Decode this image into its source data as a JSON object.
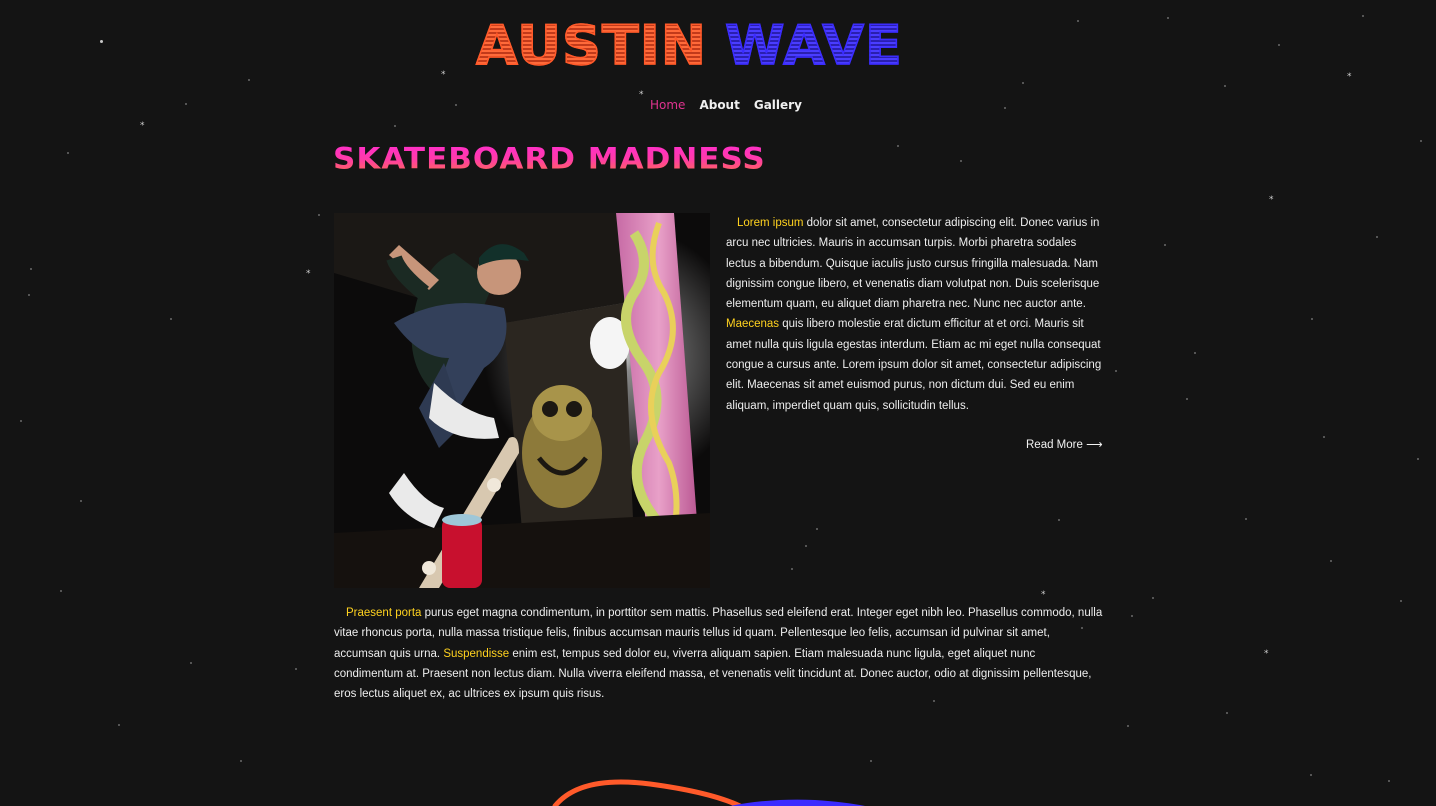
{
  "header": {
    "logo_word1": "AUSTIN",
    "logo_word2": "WAVE",
    "logo_colors": {
      "orange": "#ff5a2a",
      "blue": "#3b2cff"
    }
  },
  "nav": {
    "items": [
      {
        "label": "Home",
        "active": true
      },
      {
        "label": "About",
        "active": false
      },
      {
        "label": "Gallery",
        "active": false
      }
    ],
    "active_color": "#e0338f"
  },
  "post": {
    "title": "SKATEBOARD MADNESS",
    "title_gradient": [
      "#ff2bd6",
      "#ff7a3a"
    ],
    "image_icon": "skateboarder-photo",
    "para1": {
      "lead": "Lorem ipsum",
      "text1": " dolor sit amet, consectetur adipiscing elit. Donec varius in arcu nec ultricies. Mauris in accumsan turpis. Morbi pharetra sodales lectus a bibendum. Quisque iaculis justo cursus fringilla malesuada. Nam dignissim congue libero, et venenatis diam volutpat non. Duis scelerisque elementum quam, eu aliquet diam pharetra nec. Nunc nec auctor ante. ",
      "highlight2": "Maecenas",
      "text2": " quis libero molestie erat dictum efficitur at et orci. Mauris sit amet nulla quis ligula egestas interdum. Etiam ac mi eget nulla consequat congue a cursus ante. Lorem ipsum dolor sit amet, consectetur adipiscing elit. Maecenas sit amet euismod purus, non dictum dui. Sed eu enim aliquam, imperdiet quam quis, sollicitudin tellus."
    },
    "read_more": "Read More ⟶",
    "para2": {
      "lead": "Praesent porta",
      "text1": " purus eget magna condimentum, in porttitor sem mattis. Phasellus sed eleifend erat. Integer eget nibh leo. Phasellus commodo, nulla vitae rhoncus porta, nulla massa tristique felis, finibus accumsan mauris tellus id quam. Pellentesque leo felis, accumsan id pulvinar sit amet, accumsan quis urna. ",
      "highlight2": "Suspendisse",
      "text2": " enim est, tempus sed dolor eu, viverra aliquam sapien. Etiam malesuada nunc ligula, eget aliquet nunc condimentum at. Praesent non lectus diam. Nulla viverra eleifend massa, et venenatis velit tincidunt at. Donec auctor, odio at dignissim pellentesque, eros lectus aliquet ex, ac ultrices ex ipsum quis risus."
    },
    "highlight_color": "#ffd21f"
  },
  "background": {
    "color": "#141414"
  }
}
